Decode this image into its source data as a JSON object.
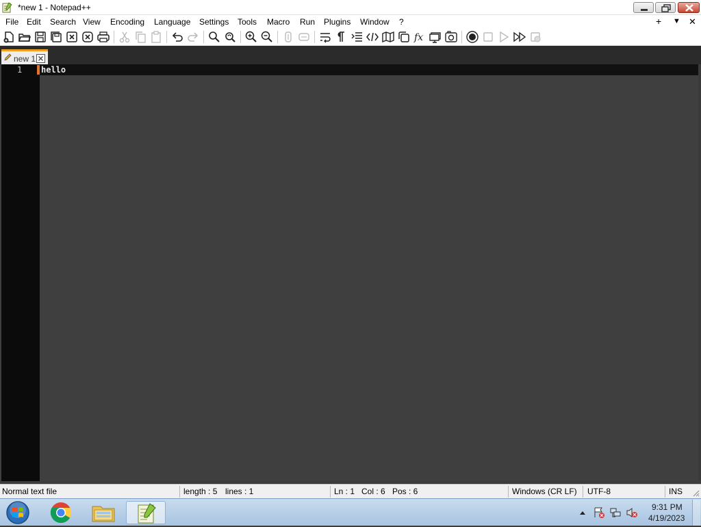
{
  "window": {
    "title": "*new 1 - Notepad++"
  },
  "menu": {
    "items": [
      "File",
      "Edit",
      "Search",
      "View",
      "Encoding",
      "Language",
      "Settings",
      "Tools",
      "Macro",
      "Run",
      "Plugins",
      "Window",
      "?"
    ],
    "right": {
      "add": "+",
      "dropdown": "▼",
      "close": "✕"
    }
  },
  "toolbar": {
    "icons": [
      "new-file-icon",
      "open-file-icon",
      "save-icon",
      "save-all-icon",
      "close-icon",
      "close-all-icon",
      "print-icon",
      "cut-icon",
      "copy-icon",
      "paste-icon",
      "undo-icon",
      "redo-icon",
      "find-icon",
      "replace-icon",
      "zoom-in-icon",
      "zoom-out-icon",
      "sync-vertical-icon",
      "sync-horizontal-icon",
      "word-wrap-icon",
      "show-all-chars-icon",
      "indent-guide-icon",
      "xml-tag-icon",
      "document-map-icon",
      "clone-icon",
      "function-list-icon",
      "monitor-icon",
      "folder-workspace-icon",
      "record-macro-icon",
      "stop-macro-icon",
      "play-macro-icon",
      "run-macro-multiple-icon",
      "save-macro-icon"
    ]
  },
  "tabs": [
    {
      "label": "new 1",
      "modified": true,
      "active": true
    }
  ],
  "editor": {
    "lines": [
      {
        "number": "1",
        "text": "hello"
      }
    ]
  },
  "status": {
    "file_type": "Normal text file",
    "length": "length : 5",
    "lines": "lines : 1",
    "ln": "Ln : 1",
    "col": "Col : 6",
    "pos": "Pos : 6",
    "eol": "Windows (CR LF)",
    "encoding": "UTF-8",
    "mode": "INS"
  },
  "taskbar": {
    "apps": [
      "windows-start-icon",
      "chrome-icon",
      "file-explorer-icon",
      "notepad-plus-plus-icon"
    ],
    "clock_time": "9:31 PM",
    "clock_date": "4/19/2023"
  },
  "colors": {
    "editor_bg": "#3f3f3f",
    "gutter_bg": "#0b0b0b",
    "current_line": "#111111",
    "tab_accent": "#f0a020",
    "fold_marker": "#e2742e"
  }
}
